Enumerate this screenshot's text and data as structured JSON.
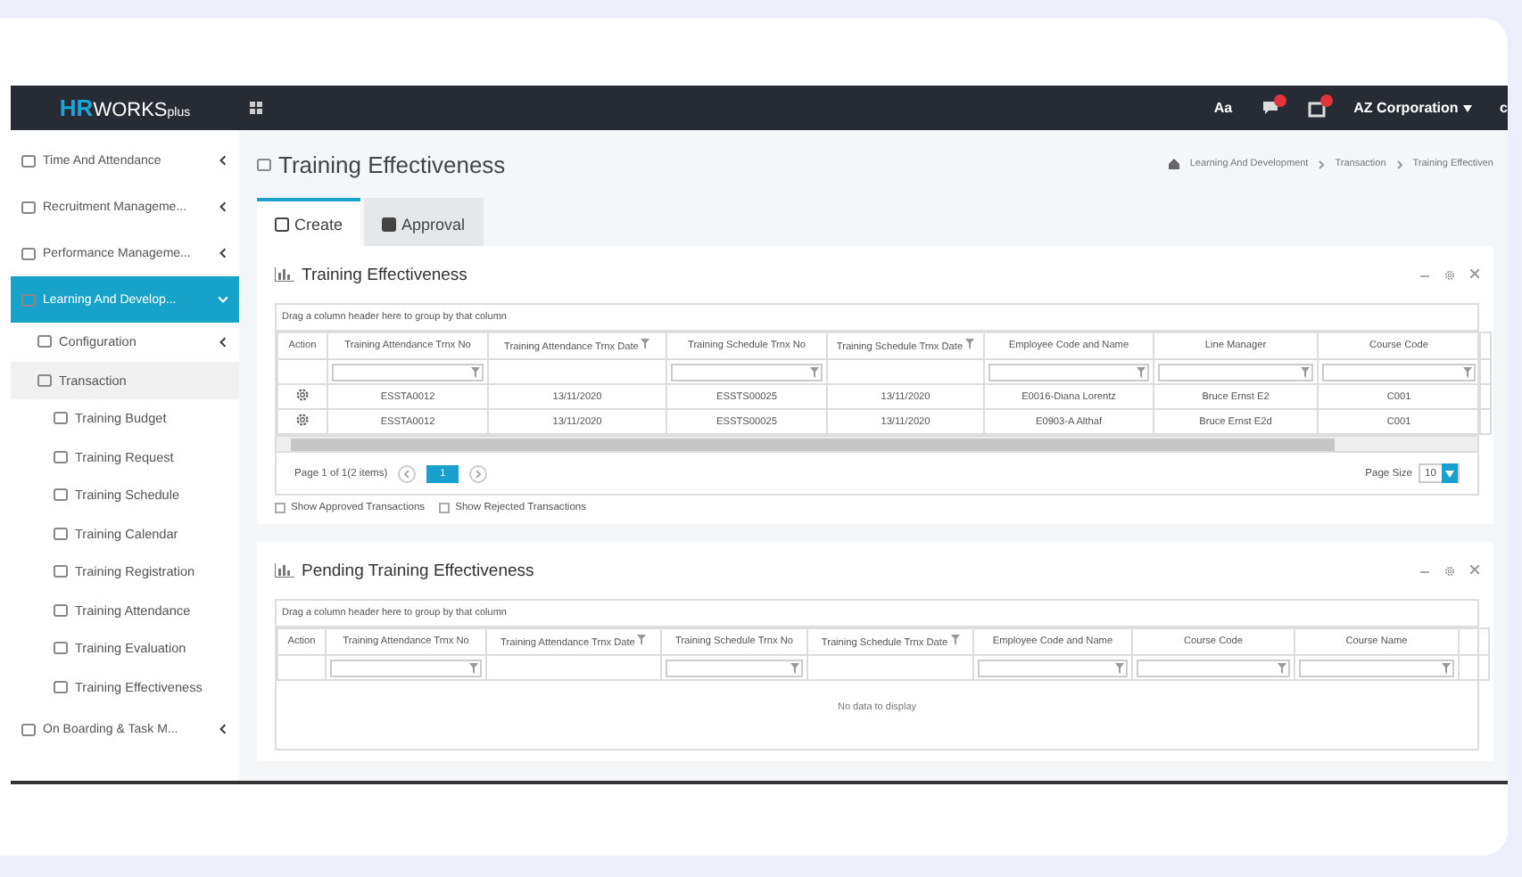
{
  "topbar": {
    "logo_bold": "HR",
    "logo_rest": "WORKS",
    "logo_small": "plus",
    "font_button": "Aa",
    "company": "AZ Corporation",
    "user_partial": "c"
  },
  "sidebar": {
    "items": [
      {
        "label": "Time And Attendance",
        "selected": false,
        "expanded": false
      },
      {
        "label": "Recruitment Manageme...",
        "selected": false,
        "expanded": false
      },
      {
        "label": "Performance Manageme...",
        "selected": false,
        "expanded": false
      },
      {
        "label": "Learning And Develop...",
        "selected": true,
        "expanded": true,
        "children": [
          {
            "label": "Configuration",
            "selected": false,
            "expanded": false
          },
          {
            "label": "Transaction",
            "selected": true,
            "expanded": true,
            "children": [
              {
                "label": "Training Budget",
                "selected": false
              },
              {
                "label": "Training Request",
                "selected": false
              },
              {
                "label": "Training Schedule",
                "selected": false
              },
              {
                "label": "Training Calendar",
                "selected": false
              },
              {
                "label": "Training Registration",
                "selected": false
              },
              {
                "label": "Training Attendance",
                "selected": false
              },
              {
                "label": "Training Evaluation",
                "selected": false
              },
              {
                "label": "Training Effectiveness",
                "selected": false
              }
            ]
          }
        ]
      },
      {
        "label": "On Boarding & Task M...",
        "selected": false,
        "expanded": false
      }
    ]
  },
  "page": {
    "title": "Training Effectiveness",
    "breadcrumb": [
      "Learning And Development",
      "Transaction",
      "Training Effectiven"
    ]
  },
  "tabs": [
    {
      "label": "Create",
      "selected": true
    },
    {
      "label": "Approval",
      "selected": false
    }
  ],
  "panels": [
    {
      "title": "Training Effectiveness",
      "group_hint": "Drag a column header here to group by that column",
      "columns": [
        {
          "label": "Action",
          "kind": "none"
        },
        {
          "label": "Training Attendance Trnx No",
          "kind": "text"
        },
        {
          "label": "Training Attendance Trnx Date",
          "kind": "date"
        },
        {
          "label": "Training Schedule Trnx No",
          "kind": "text"
        },
        {
          "label": "Training Schedule Trnx Date",
          "kind": "date"
        },
        {
          "label": "Employee Code and Name",
          "kind": "text"
        },
        {
          "label": "Line Manager",
          "kind": "text"
        },
        {
          "label": "Course Code",
          "kind": "text"
        },
        {
          "kind": "none"
        }
      ],
      "rows": [
        [
          "",
          "ESSTA0012",
          "13/11/2020",
          "ESSTS00025",
          "13/11/2020",
          "E0016-Diana Lorentz",
          "Bruce Ernst E2",
          "C001"
        ],
        [
          "",
          "ESSTA0012",
          "13/11/2020",
          "ESSTS00025",
          "13/11/2020",
          "E0903-A Althaf",
          "Bruce Ernst E2d",
          "C001"
        ]
      ],
      "pager": {
        "info": "Page 1 of 1(2 items)",
        "pages": [
          {
            "label": "1",
            "selected": true
          }
        ],
        "size_label": "Page Size",
        "size": "10"
      },
      "options": [
        {
          "label": "Show Approved Transactions",
          "checked": false
        },
        {
          "label": "Show Rejected Transactions",
          "checked": false
        }
      ]
    },
    {
      "title": "Pending Training Effectiveness",
      "group_hint": "Drag a column header here to group by that column",
      "columns": [
        {
          "label": "Action",
          "kind": "none"
        },
        {
          "label": "Training Attendance Trnx No",
          "kind": "text"
        },
        {
          "label": "Training Attendance Trnx Date",
          "kind": "date"
        },
        {
          "label": "Training Schedule Trnx No",
          "kind": "text"
        },
        {
          "label": "Training Schedule Trnx Date",
          "kind": "date"
        },
        {
          "label": "Employee Code and Name",
          "kind": "text"
        },
        {
          "label": "Course Code",
          "kind": "text"
        },
        {
          "label": "Course Name",
          "kind": "text"
        },
        {
          "kind": "none"
        }
      ],
      "empty": "No data to display"
    }
  ]
}
